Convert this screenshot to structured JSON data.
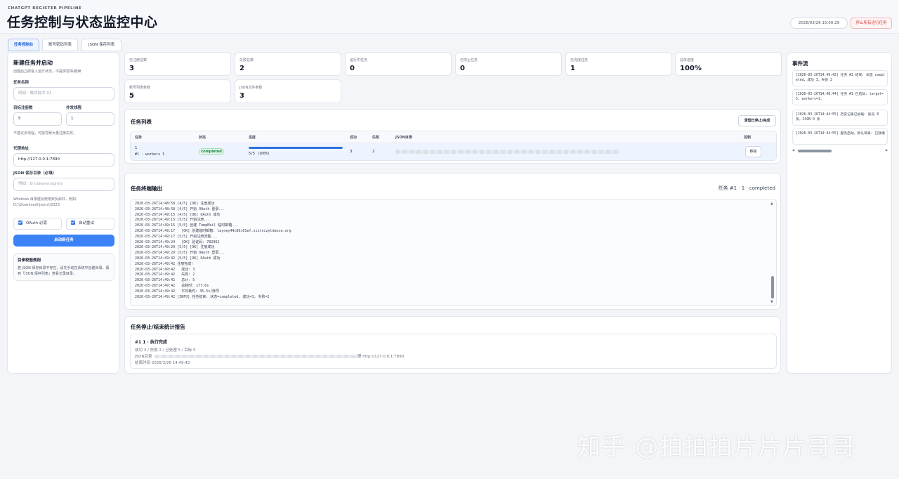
{
  "header": {
    "eyebrow": "CHATGPT REGISTER PIPELINE",
    "title": "任务控制与状态监控中心",
    "datetime": "2026/03/26 15:00:29",
    "stop_all_label": "停止所有运行任务"
  },
  "tabs": [
    {
      "label": "任务控制台",
      "active": true
    },
    {
      "label": "账号密码列表",
      "active": false
    },
    {
      "label": "JSON 保存列表",
      "active": false
    }
  ],
  "new_task": {
    "title": "新建任务并启动",
    "hint": "创建后立即进入运行状态，不提供暂停/继续",
    "name_label": "任务名称",
    "name_placeholder": "例如：晚间批次-01",
    "target_label": "目标注册数",
    "target_value": "5",
    "threads_label": "并发线程",
    "threads_value": "1",
    "threads_note": "不建议多线程，可能导致大量注册失败。",
    "proxy_label": "代理地址",
    "proxy_value": "http://127.0.0.1:7890",
    "json_dir_label": "JSON 保存目录（必填）",
    "json_dir_placeholder": "例如：D:\\tokens\\nightly",
    "windows_note_1": "Windows 目录建议使用双反斜杠，例如:",
    "windows_note_2": "D:\\\\Download\\\\jsons\\\\0323",
    "oauth_label": "OAuth 必需",
    "retry_label": "自动重试",
    "start_label": "启动新任务",
    "rules_title": "目录校验规则",
    "rules_text": "若 JSON 保存目录不存在，请先手动在系统中创建目录，再到「JSON 保存列表」查看记录目录。"
  },
  "stats": [
    {
      "label": "已注册总数",
      "value": "3"
    },
    {
      "label": "失败总数",
      "value": "2"
    },
    {
      "label": "运行中任务",
      "value": "0"
    },
    {
      "label": "已停止任务",
      "value": "0"
    },
    {
      "label": "已完成任务",
      "value": "1"
    },
    {
      "label": "总体进度",
      "value": "100%"
    },
    {
      "label": "账号列表条数",
      "value": "5"
    },
    {
      "label": "JSON文件条数",
      "value": "3"
    }
  ],
  "task_list": {
    "title": "任务列表",
    "clear_label": "清理已停止/完成",
    "columns": [
      "任务",
      "状态",
      "进度",
      "成功",
      "失败",
      "JSON目录",
      "控制"
    ],
    "rows": [
      {
        "task_id": "1",
        "task_sub": "#1 · workers 1",
        "status": "completed",
        "progress_fraction": 1.0,
        "progress_text": "5/5 (100%)",
        "success": "3",
        "fail": "2",
        "remove_label": "移除"
      }
    ]
  },
  "terminal": {
    "title": "任务终端输出",
    "task_status": "任务 #1 · 1 · completed",
    "lines": [
      "2026-03-26T14:48:58 [4/5] [OK] 注册成功",
      "2026-03-26T14:48:58 [4/5] 开始 OAuth 登录...",
      "2026-03-26T14:49:15 [4/5] [OK] OAuth 成功",
      "2026-03-26T14:49:15 [5/5] 开始注册...",
      "2026-03-26T14:49:15 [5/5] 创建 TempMail 临时邮箱...",
      "2026-03-26T14:49:17   [OK] 创建临时邮箱: layney44c86c01ef.sixtnizytdance.org",
      "2026-03-26T14:49:17 [5/5] 开始注册流程...",
      "2026-03-26T14:49:24   [OK] 验证码: 782962",
      "2026-03-26T14:49:29 [5/5] [OK] 注册成功",
      "2026-03-26T14:49:29 [5/5] 开始 OAuth 登录...",
      "2026-03-26T14:49:42 [5/5] [OK] OAuth 成功",
      "2026-03-26T14:49:42 注册完成!",
      "2026-03-26T14:49:42   成功: 3",
      "2026-03-26T14:49:42   失败: 2",
      "2026-03-26T14:49:42   总计: 5",
      "2026-03-26T14:49:42   总耗时: 177.6s",
      "2026-03-26T14:49:42   平均耗时: 35.5s/账号",
      "2026-03-26T14:49:42 [INFO] 任务结束: 状态=completed, 成功=3, 失败=2"
    ]
  },
  "report": {
    "title": "任务停止/结束统计报告",
    "item_title": "#1 1 · 执行完成",
    "summary": "成功 3 / 失败 2 / 已处理 5 / 目标 5",
    "json_prefix": "JSON目录",
    "proxy_suffix": "理 http://127.0.0.1:7890",
    "end_time": "结束时间 2026/3/26 14:49:42"
  },
  "events": {
    "title": "事件流",
    "items": [
      "[2026-03-26T14:49:42] 任务 #1 结束: 状态 completed，成功 3，失败 2",
      "[2026-03-26T14:48:44] 任务 #1 已启动: target=5, workers=1,",
      "[2026-03-26T14:44:55] 历史记录已加载: 账号 0 条，JSON 0 条",
      "[2026-03-26T14:44:55] 服务启动，默认目录: 已就绪"
    ]
  },
  "watermark": "知乎 @拍拍拍片片片哥哥",
  "colors": {
    "accent": "#2f6fe0",
    "success": "#15803d",
    "danger": "#d33a3a"
  }
}
